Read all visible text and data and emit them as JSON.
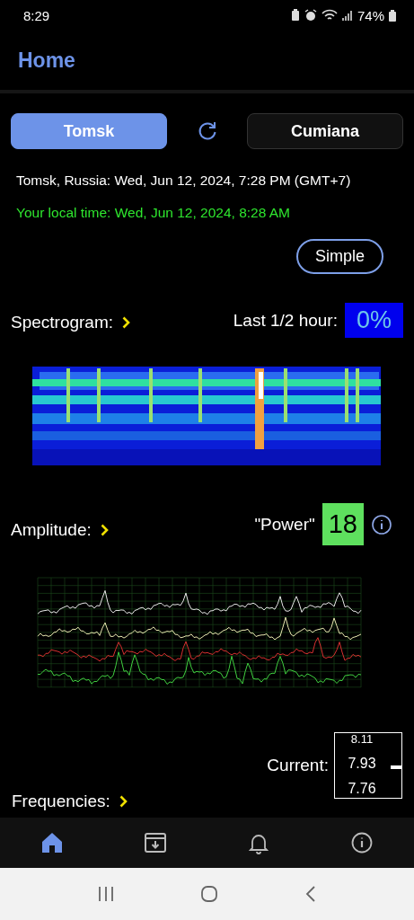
{
  "status_bar": {
    "time": "8:29",
    "battery": "74%"
  },
  "header": {
    "title": "Home"
  },
  "locations": [
    {
      "label": "Tomsk",
      "selected": true
    },
    {
      "label": "Cumiana",
      "selected": false
    }
  ],
  "remote_time": "Tomsk, Russia: Wed, Jun 12, 2024, 7:28 PM (GMT+7)",
  "local_time": "Your local time: Wed, Jun 12, 2024, 8:28 AM",
  "mode_button": "Simple",
  "spectrogram": {
    "label": "Spectrogram:",
    "last_label": "Last 1/2 hour:",
    "last_value": "0%"
  },
  "amplitude": {
    "label": "Amplitude:",
    "power_label": "\"Power\"",
    "power_value": "18"
  },
  "current": {
    "label": "Current:",
    "values": [
      "8.11",
      "7.93",
      "7.76"
    ]
  },
  "frequencies": {
    "label": "Frequencies:"
  },
  "nav": [
    {
      "kind": "home",
      "selected": true
    },
    {
      "kind": "archive",
      "selected": false
    },
    {
      "kind": "bell",
      "selected": false
    },
    {
      "kind": "info",
      "selected": false
    }
  ]
}
